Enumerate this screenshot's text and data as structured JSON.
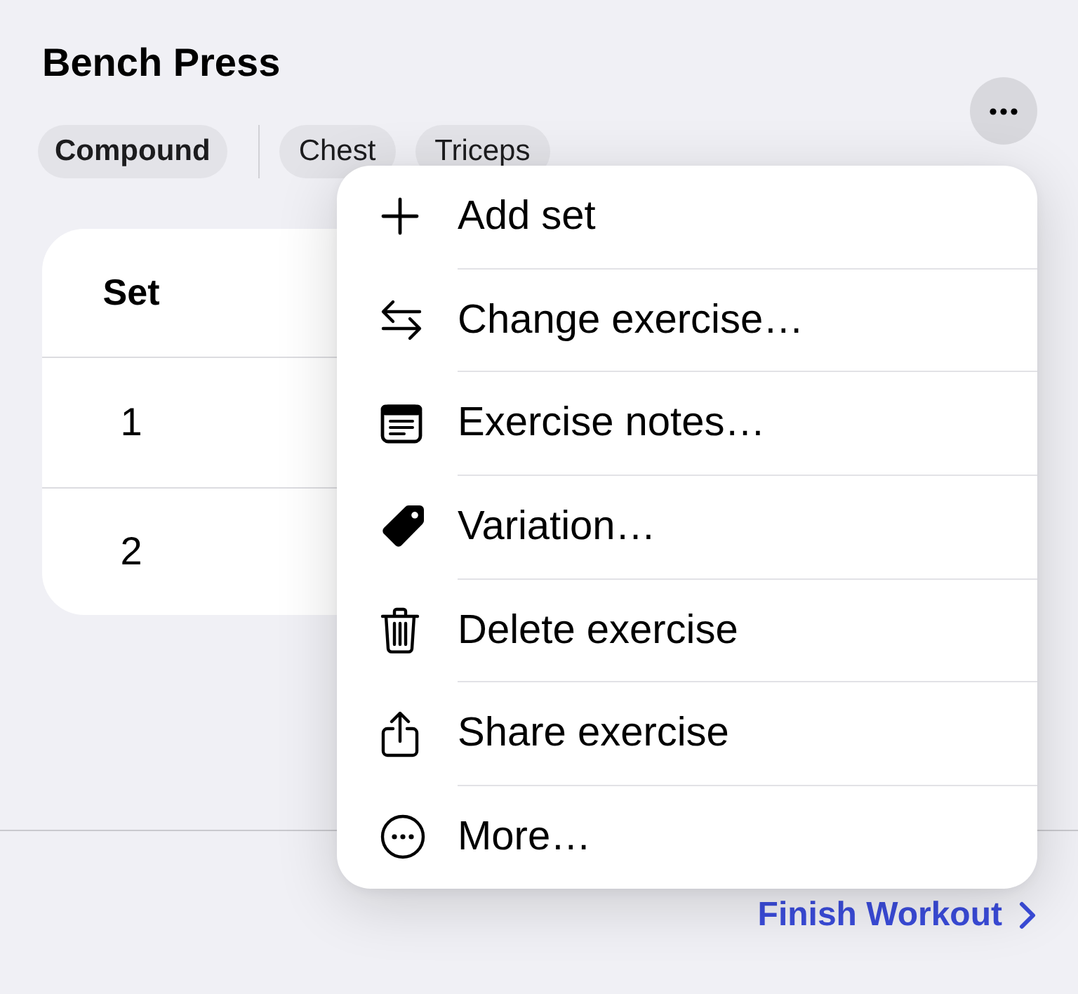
{
  "exercise": {
    "title": "Bench Press",
    "category": "Compound",
    "muscles": [
      "Chest",
      "Triceps"
    ]
  },
  "table": {
    "columns": [
      "Set"
    ],
    "rows": [
      [
        "1"
      ],
      [
        "2"
      ]
    ]
  },
  "menu": {
    "items": [
      {
        "label": "Add set"
      },
      {
        "label": "Change exercise…"
      },
      {
        "label": "Exercise notes…"
      },
      {
        "label": "Variation…"
      },
      {
        "label": "Delete exercise"
      },
      {
        "label": "Share exercise"
      },
      {
        "label": "More…"
      }
    ]
  },
  "footer": {
    "link": "Finish Workout"
  }
}
